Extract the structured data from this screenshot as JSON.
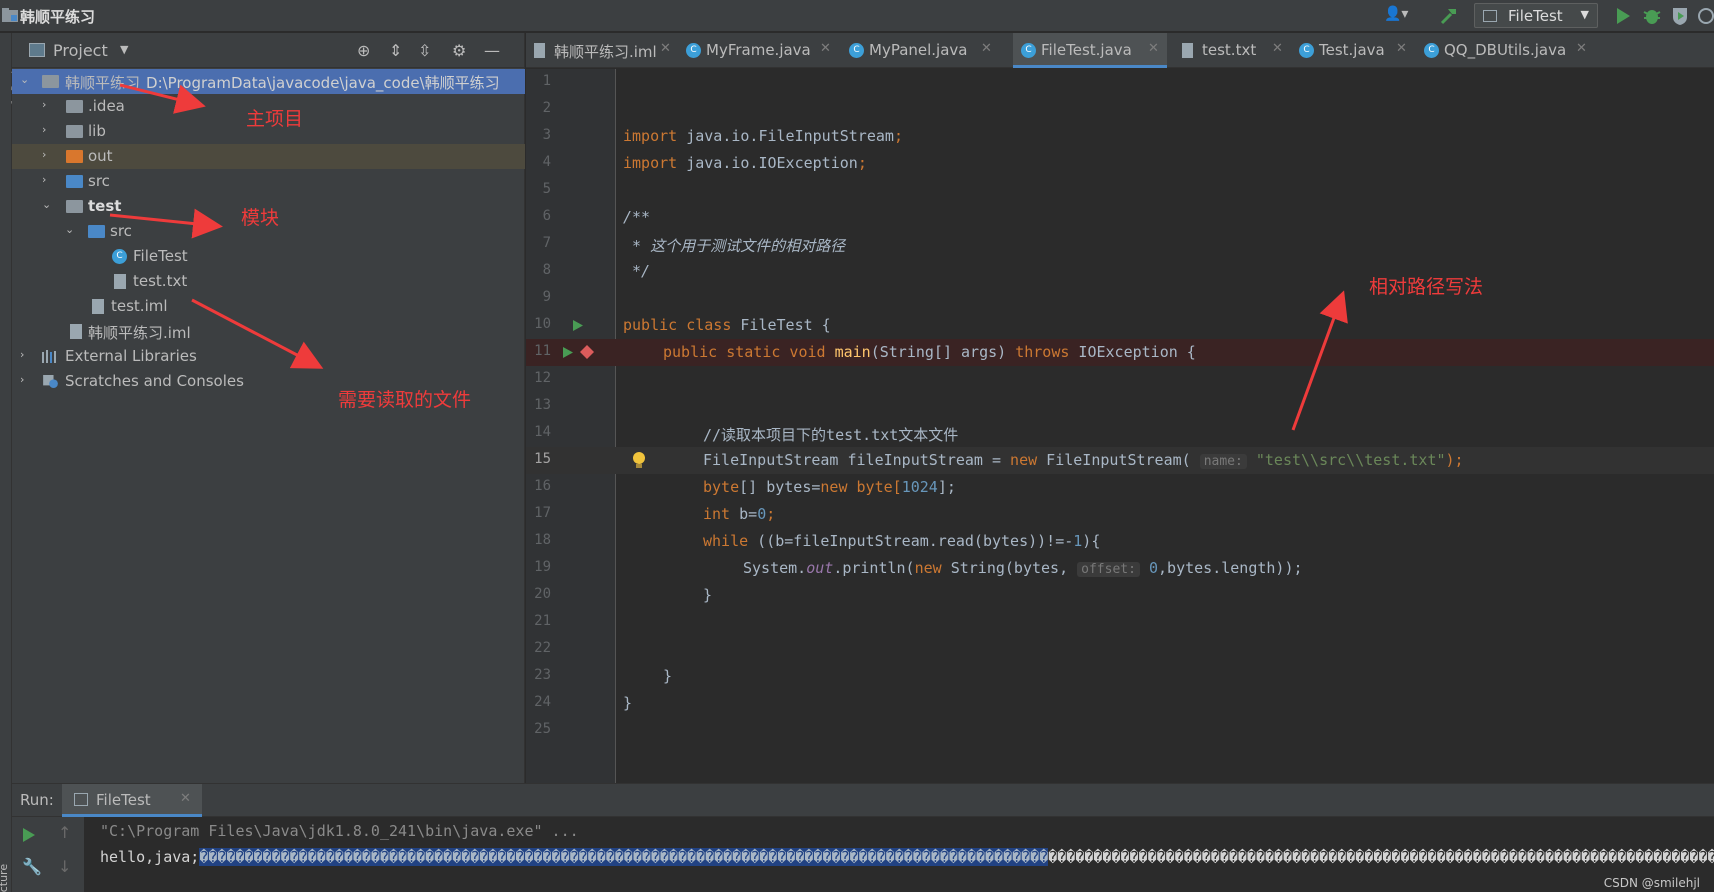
{
  "window": {
    "title": "韩顺平练习"
  },
  "toolbar": {
    "run_config": "FileTest"
  },
  "project_panel": {
    "title": "Project",
    "tree": [
      {
        "label": "韩顺平练习",
        "path": "D:\\ProgramData\\javacode\\java_code\\韩顺平练习",
        "kind": "module",
        "expanded": true,
        "depth": 0
      },
      {
        "label": ".idea",
        "kind": "folder",
        "depth": 1
      },
      {
        "label": "lib",
        "kind": "folder",
        "depth": 1
      },
      {
        "label": "out",
        "kind": "folder-excluded",
        "depth": 1
      },
      {
        "label": "src",
        "kind": "source-folder",
        "depth": 1
      },
      {
        "label": "test",
        "kind": "module",
        "expanded": true,
        "depth": 1
      },
      {
        "label": "src",
        "kind": "source-folder",
        "expanded": true,
        "depth": 2
      },
      {
        "label": "FileTest",
        "kind": "java-class",
        "depth": 3
      },
      {
        "label": "test.txt",
        "kind": "text-file",
        "depth": 3
      },
      {
        "label": "test.iml",
        "kind": "iml-file",
        "depth": 2
      },
      {
        "label": "韩顺平练习.iml",
        "kind": "iml-file",
        "depth": 1
      },
      {
        "label": "External Libraries",
        "kind": "libraries",
        "depth": 0
      },
      {
        "label": "Scratches and Consoles",
        "kind": "scratches",
        "depth": 0
      }
    ]
  },
  "annotations": {
    "main_project": "主项目",
    "module": "模块",
    "file_to_read": "需要读取的文件",
    "relative_path": "相对路径写法"
  },
  "editor": {
    "tabs": [
      {
        "label": "韩顺平练习.iml",
        "icon": "iml-file",
        "active": false
      },
      {
        "label": "MyFrame.java",
        "icon": "java-class",
        "active": false
      },
      {
        "label": "MyPanel.java",
        "icon": "java-class",
        "active": false
      },
      {
        "label": "FileTest.java",
        "icon": "java-class",
        "active": true
      },
      {
        "label": "test.txt",
        "icon": "text-file",
        "active": false
      },
      {
        "label": "Test.java",
        "icon": "java-class",
        "active": false
      },
      {
        "label": "QQ_DBUtils.java",
        "icon": "java-class",
        "active": false
      }
    ],
    "line_numbers": [
      "1",
      "2",
      "3",
      "4",
      "5",
      "6",
      "7",
      "8",
      "9",
      "10",
      "11",
      "12",
      "13",
      "14",
      "15",
      "16",
      "17",
      "18",
      "19",
      "20",
      "21",
      "22",
      "23",
      "24",
      "25"
    ],
    "current_line": 15,
    "code": {
      "import1_kw": "import",
      "import1": " java.io.FileInputStream",
      "import2_kw": "import",
      "import2": " java.io.IOException",
      "semi": ";",
      "doc_open": "/**",
      "doc_body": " * 这个用于测试文件的相对路径",
      "doc_close": " */",
      "class_kw": "public class",
      "class_name": " FileTest {",
      "main_kw": "public static void",
      "main_name": "main",
      "main_args": "(String[] args) ",
      "throws_kw": "throws",
      "main_tail": " IOException {",
      "comment": "//读取本项目下的test.txt文本文件",
      "l15_a": "FileInputStream fileInputStream = ",
      "new_kw": "new",
      "l15_b": " FileInputStream(",
      "hint_name": "name:",
      "path_str": "\"test\\\\src\\\\test.txt\"",
      "l15_c": ");",
      "byte_kw": "byte",
      "l16_a": "[] bytes=",
      "l16_b": " byte[",
      "num_1024": "1024",
      "l16_c": "];",
      "int_kw": "int",
      "l17_a": " b=",
      "num_0": "0",
      "while_kw": "while",
      "l18_a": " ((b=fileInputStream.read(bytes))!=-",
      "num_1": "1",
      "l18_b": "){",
      "l19_a": "System.",
      "out_field": "out",
      "l19_b": ".println(",
      "l19_c": " String(bytes, ",
      "hint_offset": "offset:",
      "l19_d": ",bytes.length));",
      "close_brace": "}"
    }
  },
  "run_panel": {
    "label": "Run:",
    "tab": "FileTest",
    "console_cmd": "\"C:\\Program Files\\Java\\jdk1.8.0_241\\bin\\java.exe\" ...",
    "console_output_prefix": "hello,java;",
    "console_output_selected": "����������������������������������������������������������������������������������������������",
    "console_output_rest": "����������������������������������������������������������������������������������������������������������������������������������������������������������������������������������"
  },
  "watermark": "CSDN @smilehjl",
  "colors": {
    "accent": "#4a88c7",
    "selection": "#4b6eaf",
    "annotation": "#ee3b3b",
    "keyword": "#cc7832",
    "string": "#6a8759"
  }
}
